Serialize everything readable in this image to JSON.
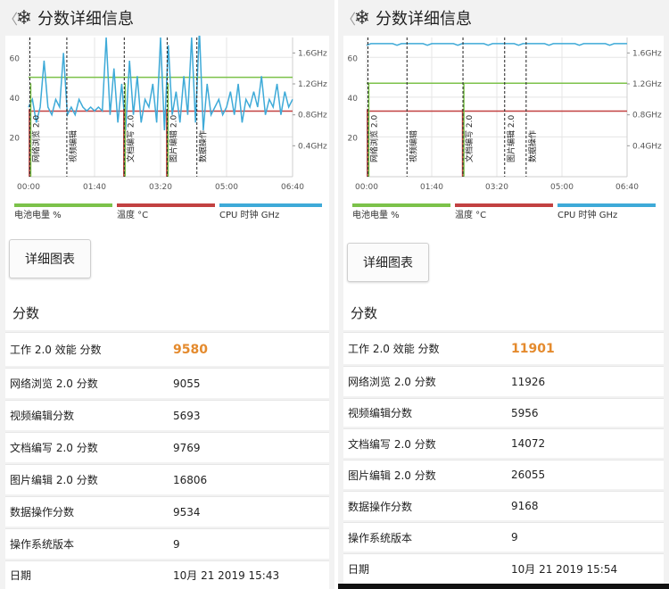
{
  "colors": {
    "battery": "#7cc24a",
    "temp": "#c24141",
    "cpu": "#3eaad8",
    "score": "#e48a2d"
  },
  "panels": [
    {
      "header": {
        "back": "〈",
        "snow": "❄",
        "title": "分数详细信息"
      },
      "chart": {
        "y_left_ticks": [
          "60",
          "40",
          "20"
        ],
        "y_right_ticks": [
          "1.6GHz",
          "1.2GHz",
          "0.8GHz",
          "0.4GHz"
        ],
        "x_ticks": [
          "00:00",
          "01:40",
          "03:20",
          "05:00",
          "06:40"
        ],
        "markers": [
          "网络浏览 2.0",
          "视频编辑",
          "文档编写 2.0",
          "图片编辑 2.0",
          "数据操作"
        ],
        "legend": [
          "电池电量 %",
          "温度 °C",
          "CPU 时钟 GHz"
        ]
      },
      "button": "详细图表",
      "scores_title": "分数",
      "rows": [
        {
          "k": "工作 2.0 效能 分数",
          "v": "9580"
        },
        {
          "k": "网络浏览 2.0 分数",
          "v": "9055"
        },
        {
          "k": "视频编辑分数",
          "v": "5693"
        },
        {
          "k": "文档编写 2.0 分数",
          "v": "9769"
        },
        {
          "k": "图片编辑 2.0 分数",
          "v": "16806"
        },
        {
          "k": "数据操作分数",
          "v": "9534"
        },
        {
          "k": "操作系统版本",
          "v": "9"
        },
        {
          "k": "日期",
          "v": "10月 21 2019 15:43"
        }
      ]
    },
    {
      "header": {
        "back": "〈",
        "snow": "❄",
        "title": "分数详细信息"
      },
      "chart": {
        "y_left_ticks": [
          "60",
          "40",
          "20"
        ],
        "y_right_ticks": [
          "1.6GHz",
          "1.2GHz",
          "0.8GHz",
          "0.4GHz"
        ],
        "x_ticks": [
          "00:00",
          "01:40",
          "03:20",
          "05:00",
          "06:40"
        ],
        "markers": [
          "网络浏览 2.0",
          "视频编辑",
          "文档编写 2.0",
          "图片编辑 2.0",
          "数据操作"
        ],
        "legend": [
          "电池电量 %",
          "温度 °C",
          "CPU 时钟 GHz"
        ]
      },
      "button": "详细图表",
      "scores_title": "分数",
      "rows": [
        {
          "k": "工作 2.0 效能 分数",
          "v": "11901"
        },
        {
          "k": "网络浏览 2.0 分数",
          "v": "11926"
        },
        {
          "k": "视频编辑分数",
          "v": "5956"
        },
        {
          "k": "文档编写 2.0 分数",
          "v": "14072"
        },
        {
          "k": "图片编辑 2.0 分数",
          "v": "26055"
        },
        {
          "k": "数据操作分数",
          "v": "9168"
        },
        {
          "k": "操作系统版本",
          "v": "9"
        },
        {
          "k": "日期",
          "v": "10月 21 2019 15:54"
        }
      ]
    }
  ]
}
